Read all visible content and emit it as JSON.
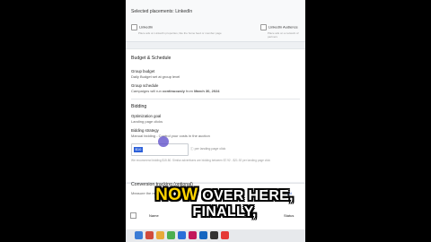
{
  "top_panel": {
    "title": "Selected placements: LinkedIn",
    "placements": [
      {
        "label": "LinkedIn",
        "sub": "Place ads on LinkedIn properties, like the home feed or member page"
      },
      {
        "label": "LinkedIn Audience",
        "sub": "Place ads on a network of partners"
      }
    ]
  },
  "budget": {
    "section_title": "Budget & Schedule",
    "group_budget_label": "Group budget",
    "group_budget_value": "Daily Budget set at group level",
    "group_schedule_label": "Group schedule",
    "group_schedule_prefix": "Campaigns will run",
    "group_schedule_bold": "continuously",
    "group_schedule_suffix": "from",
    "group_schedule_date": "March 30, 2024"
  },
  "bidding": {
    "section_title": "Bidding",
    "goal_label": "Optimization goal",
    "goal_value": "Landing page clicks",
    "strategy_label": "Bidding strategy",
    "strategy_value": "Manual bidding - Control your costs in the auction",
    "bid_selected": "$10",
    "per_label": "per landing page click",
    "hint": "We recommend bidding $15.80. Similar advertisers are bidding between $7.92 - $21.92 per landing page click"
  },
  "conversion": {
    "section_title": "Conversion tracking (optional)",
    "description": "Measure the results of your campaign",
    "link_label": "LinkedIn ad",
    "col_name": "Name",
    "col_status": "Status"
  },
  "caption": {
    "highlight": "NOW",
    "line1_rest": "OVER HERE,",
    "line2": "FINALLY,"
  },
  "colors": {
    "accent": "#2b5fd9",
    "cursor": "#5848c8",
    "caption_highlight": "#ffd400"
  }
}
